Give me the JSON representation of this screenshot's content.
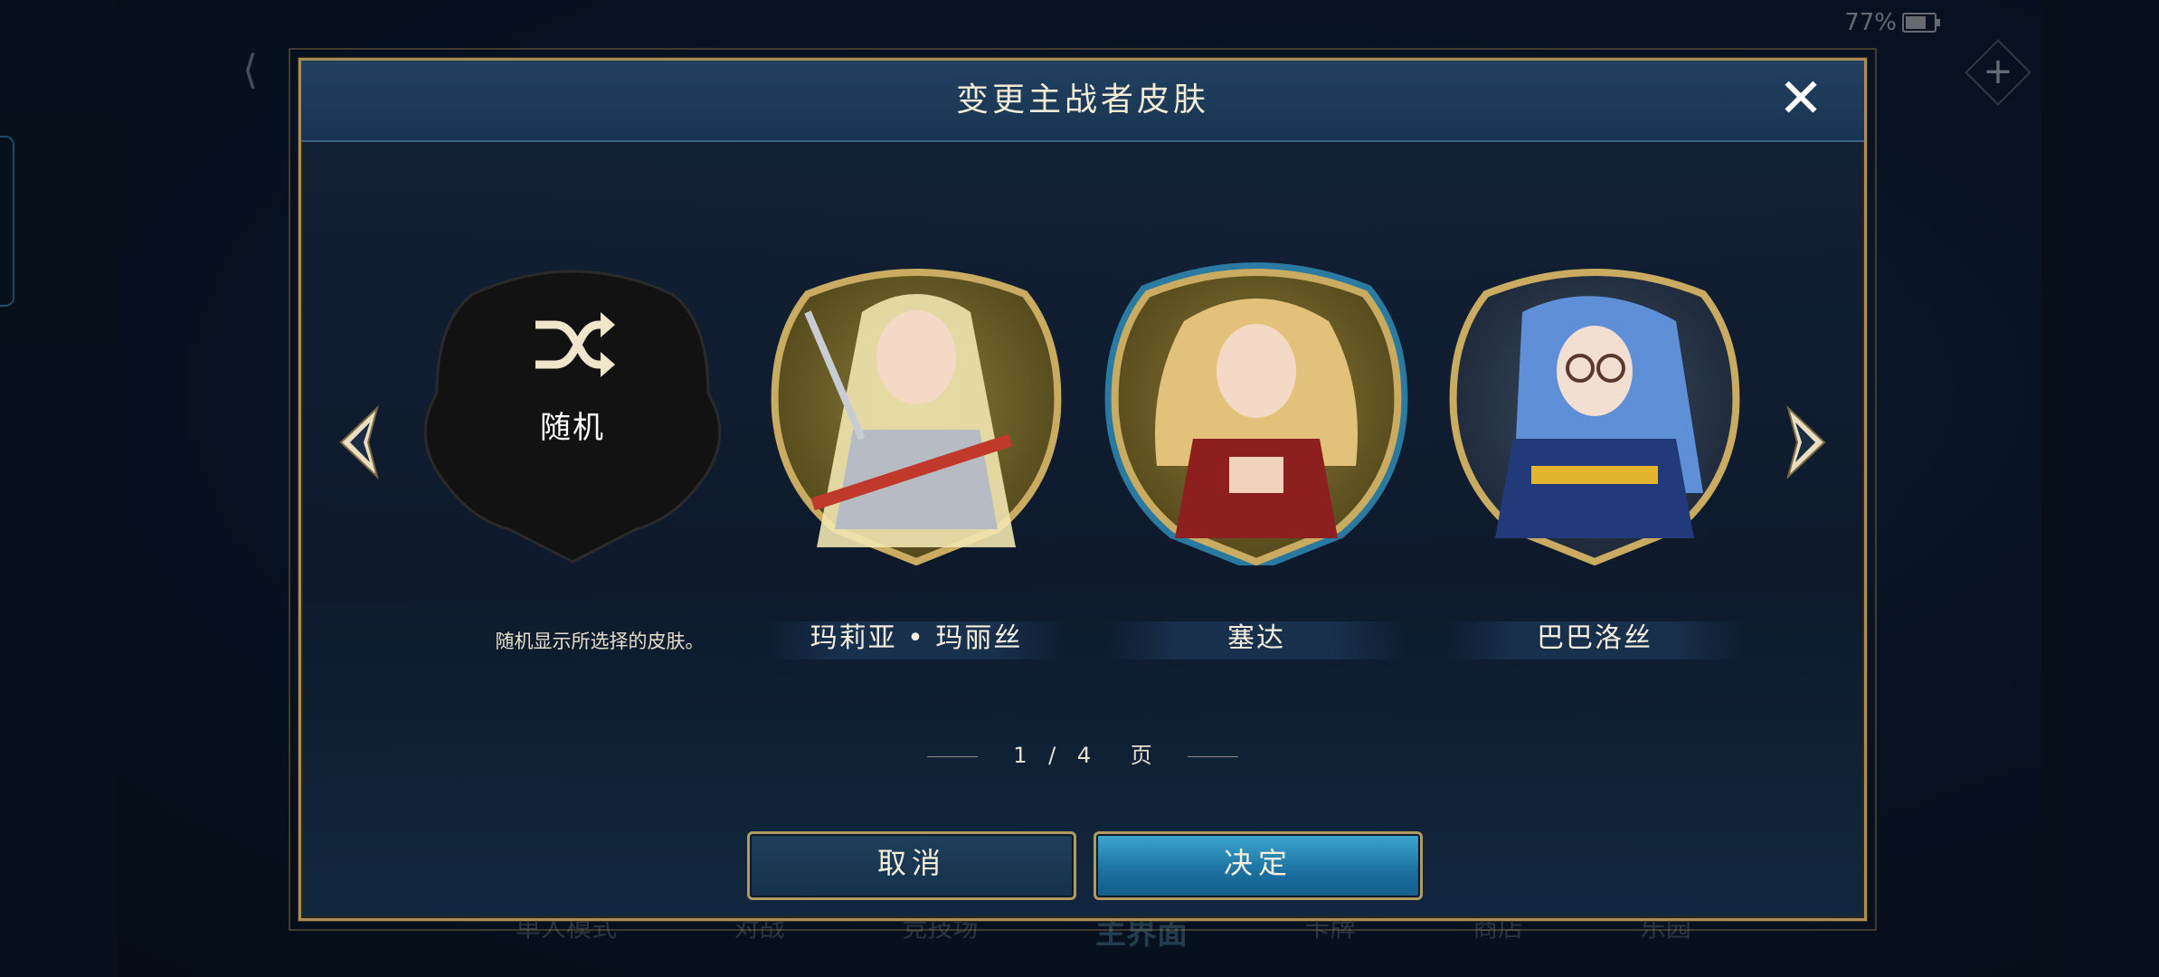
{
  "status": {
    "battery": "77%"
  },
  "background": {
    "bottom_nav": [
      "单人模式",
      "对战",
      "竞技场",
      "主界面",
      "卡牌",
      "商店",
      "乐园"
    ]
  },
  "dialog": {
    "title": "变更主战者皮肤",
    "close_icon": "close-icon",
    "skins": [
      {
        "name": "随机",
        "description": "随机显示所选择的皮肤。",
        "icon": "shuffle-icon",
        "selected": false
      },
      {
        "name": "玛莉亚 • 玛丽丝",
        "selected": false
      },
      {
        "name": "塞达",
        "selected": true
      },
      {
        "name": "巴巴洛丝",
        "selected": false
      }
    ],
    "pager": {
      "current": "1",
      "separator": "/",
      "total": "4",
      "unit": "页"
    },
    "buttons": {
      "cancel": "取消",
      "confirm": "决定"
    }
  },
  "colors": {
    "gold_frame": "#a88d58",
    "selected_glow": "#3fc6ff",
    "confirm_button": "#2b8dbd"
  }
}
